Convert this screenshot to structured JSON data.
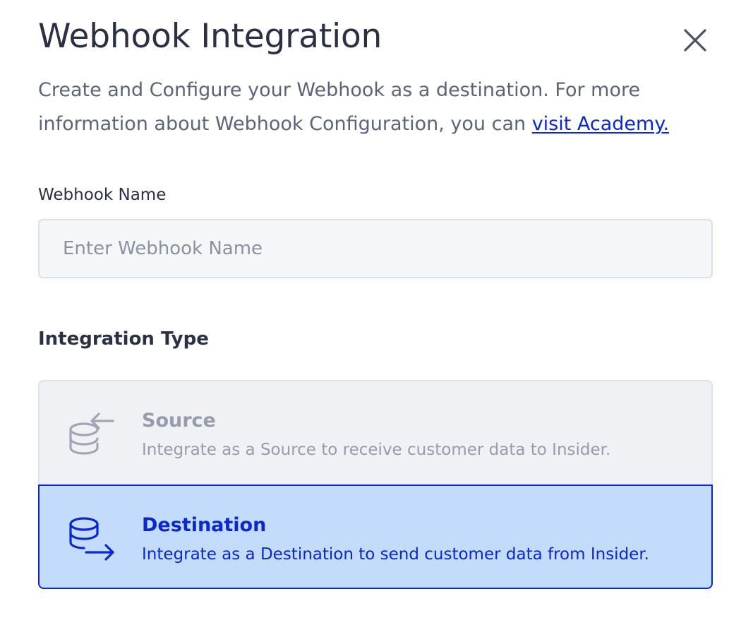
{
  "header": {
    "title": "Webhook Integration",
    "close_icon": "close-icon"
  },
  "description": {
    "text": "Create and Configure your Webhook as a destination. For more information about Webhook Configuration, you can ",
    "link_text": "visit Academy."
  },
  "webhook_name": {
    "label": "Webhook Name",
    "value": "",
    "placeholder": "Enter Webhook Name"
  },
  "integration_type": {
    "title": "Integration Type",
    "selected": "Destination",
    "options": [
      {
        "title": "Source",
        "description": "Integrate as a Source to receive customer data to Insider.",
        "icon": "database-incoming-icon",
        "selected": false
      },
      {
        "title": "Destination",
        "description": "Integrate as a Destination to send customer data from Insider.",
        "icon": "database-outgoing-icon",
        "selected": true
      }
    ]
  },
  "colors": {
    "accent": "#0a27d0",
    "selected_bg": "#c3dcfb",
    "unselected_bg": "#f0f1f4",
    "muted_text": "#969cab"
  }
}
